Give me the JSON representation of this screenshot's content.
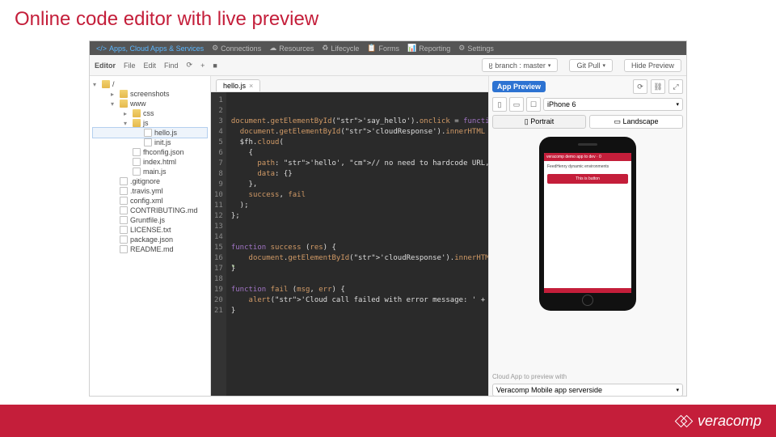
{
  "slide_title": "Online code editor with live preview",
  "topnav": {
    "active": "Apps, Cloud Apps & Services",
    "items": [
      "Connections",
      "Resources",
      "Lifecycle",
      "Forms",
      "Reporting",
      "Settings"
    ]
  },
  "toolbar": {
    "editor": "Editor",
    "file": "File",
    "edit": "Edit",
    "find": "Find",
    "branch_label": "branch : master",
    "git_pull": "Git Pull",
    "hide_preview": "Hide Preview"
  },
  "filetree": {
    "root": "/",
    "items": [
      {
        "name": "screenshots",
        "type": "folder",
        "indent": 2
      },
      {
        "name": "www",
        "type": "folder",
        "indent": 2,
        "open": true
      },
      {
        "name": "css",
        "type": "folder",
        "indent": 3
      },
      {
        "name": "js",
        "type": "folder",
        "indent": 3,
        "open": true
      },
      {
        "name": "hello.js",
        "type": "file",
        "indent": 4,
        "selected": true
      },
      {
        "name": "init.js",
        "type": "file",
        "indent": 4
      },
      {
        "name": "fhconfig.json",
        "type": "file",
        "indent": 3
      },
      {
        "name": "index.html",
        "type": "file",
        "indent": 3
      },
      {
        "name": "main.js",
        "type": "file",
        "indent": 3
      },
      {
        "name": ".gitignore",
        "type": "file",
        "indent": 2
      },
      {
        "name": ".travis.yml",
        "type": "file",
        "indent": 2
      },
      {
        "name": "config.xml",
        "type": "file",
        "indent": 2
      },
      {
        "name": "CONTRIBUTING.md",
        "type": "file",
        "indent": 2
      },
      {
        "name": "Gruntfile.js",
        "type": "file",
        "indent": 2
      },
      {
        "name": "LICENSE.txt",
        "type": "file",
        "indent": 2
      },
      {
        "name": "package.json",
        "type": "file",
        "indent": 2
      },
      {
        "name": "README.md",
        "type": "file",
        "indent": 2
      }
    ]
  },
  "tab": {
    "label": "hello.js"
  },
  "code": {
    "lines": [
      "",
      "",
      "document.getElementById('say_hello').onclick = function () {",
      "  document.getElementById('cloudResponse').innerHTML = \"<p style=",
      "  $fh.cloud(",
      "    {",
      "      path: 'hello', // no need to hardcode URL, just call endpoint",
      "      data: {}",
      "    },",
      "    success, fail",
      "  );",
      "};",
      "",
      "",
      "function success (res) {",
      "    document.getElementById('cloudResponse').innerHTML = \"<p>",
      "}",
      "",
      "function fail (msg, err) {",
      "    alert('Cloud call failed with error message: ' + msg + '",
      "}"
    ]
  },
  "preview": {
    "title": "App Preview",
    "device": "iPhone 6",
    "portrait": "Portrait",
    "landscape": "Landscape",
    "phone_header": "veracomp demo app to dev · 0",
    "phone_text": "FeedHenry dynamic environments",
    "phone_button": "This is button",
    "cloud_label": "Cloud App to preview with",
    "cloud_value": "Veracomp Mobile app serverside"
  },
  "footer_logo": "veracomp"
}
